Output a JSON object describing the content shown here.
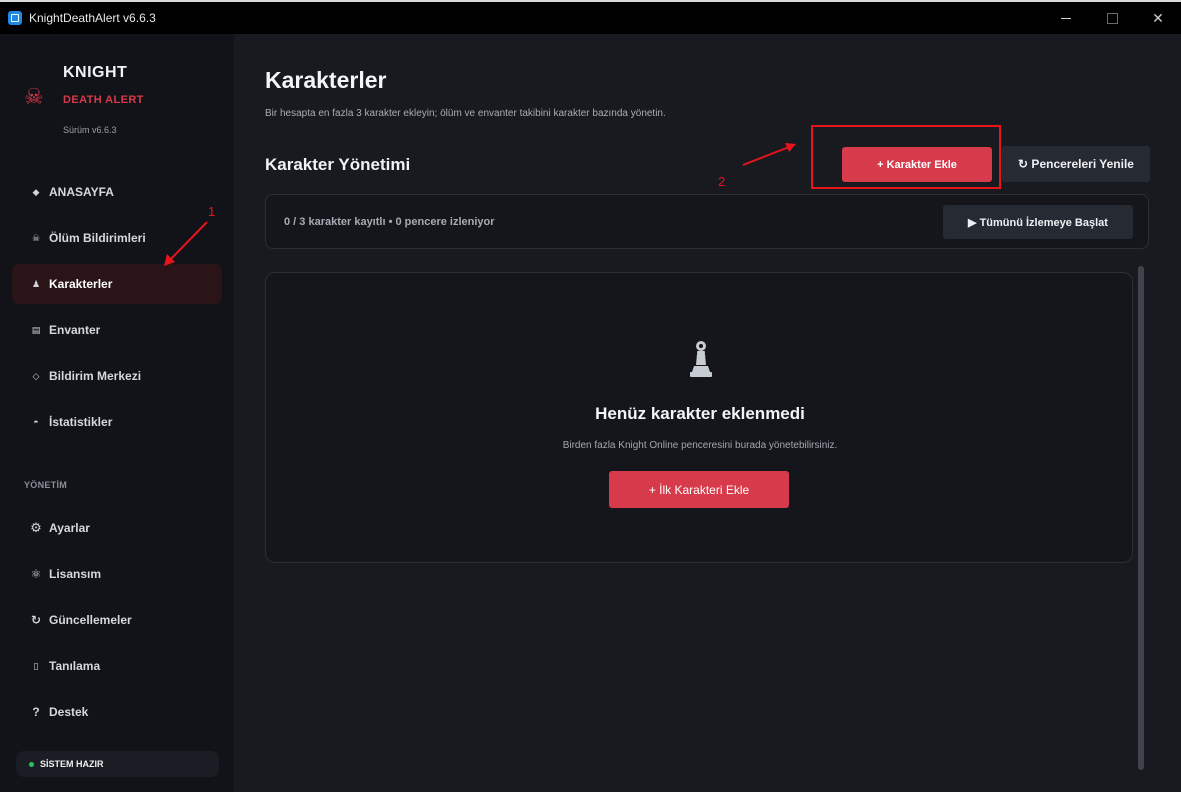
{
  "window": {
    "title": "KnightDeathAlert v6.6.3"
  },
  "brand": {
    "name": "KNIGHT",
    "tagline": "DEATH ALERT",
    "skull_glyph": "☠",
    "version": "Sürüm v6.6.3"
  },
  "sidebar": {
    "items": [
      {
        "icon": "◆",
        "label": "ANASAYFA"
      },
      {
        "icon": "☠",
        "label": "Ölüm Bildirimleri"
      },
      {
        "icon": "♟",
        "label": "Karakterler"
      },
      {
        "icon": "▤",
        "label": "Envanter"
      },
      {
        "icon": "◇",
        "label": "Bildirim Merkezi"
      },
      {
        "icon": "◓",
        "label": "İstatistikler"
      }
    ],
    "section_label": "YÖNETİM",
    "admin_items": [
      {
        "icon": "⚙",
        "label": "Ayarlar"
      },
      {
        "icon": "⚛",
        "label": "Lisansım"
      },
      {
        "icon": "↻",
        "label": "Güncellemeler"
      },
      {
        "icon": "▯",
        "label": "Tanılama"
      },
      {
        "icon": "?",
        "label": "Destek"
      }
    ],
    "status": "SİSTEM HAZIR"
  },
  "main": {
    "title": "Karakterler",
    "subtitle": "Bir hesapta en fazla 3 karakter ekleyin; ölüm ve envanter takibini karakter bazında yönetin.",
    "section_title": "Karakter Yönetimi",
    "add_button": "+ Karakter Ekle",
    "refresh_button": "↻ Pencereleri Yenile",
    "status_text": "0 / 3 karakter kayıtlı • 0 pencere izleniyor",
    "watch_all_button": "▶ Tümünü İzlemeye Başlat",
    "empty": {
      "title": "Henüz karakter eklenmedi",
      "subtitle": "Birden fazla Knight Online penceresini burada yönetebilirsiniz.",
      "button": "+ İlk Karakteri Ekle"
    }
  },
  "annotations": {
    "marker_1": "1",
    "marker_2": "2",
    "color": "#e8141a"
  },
  "colors": {
    "accent": "#d63a4b",
    "status_ok": "#22c55e"
  }
}
